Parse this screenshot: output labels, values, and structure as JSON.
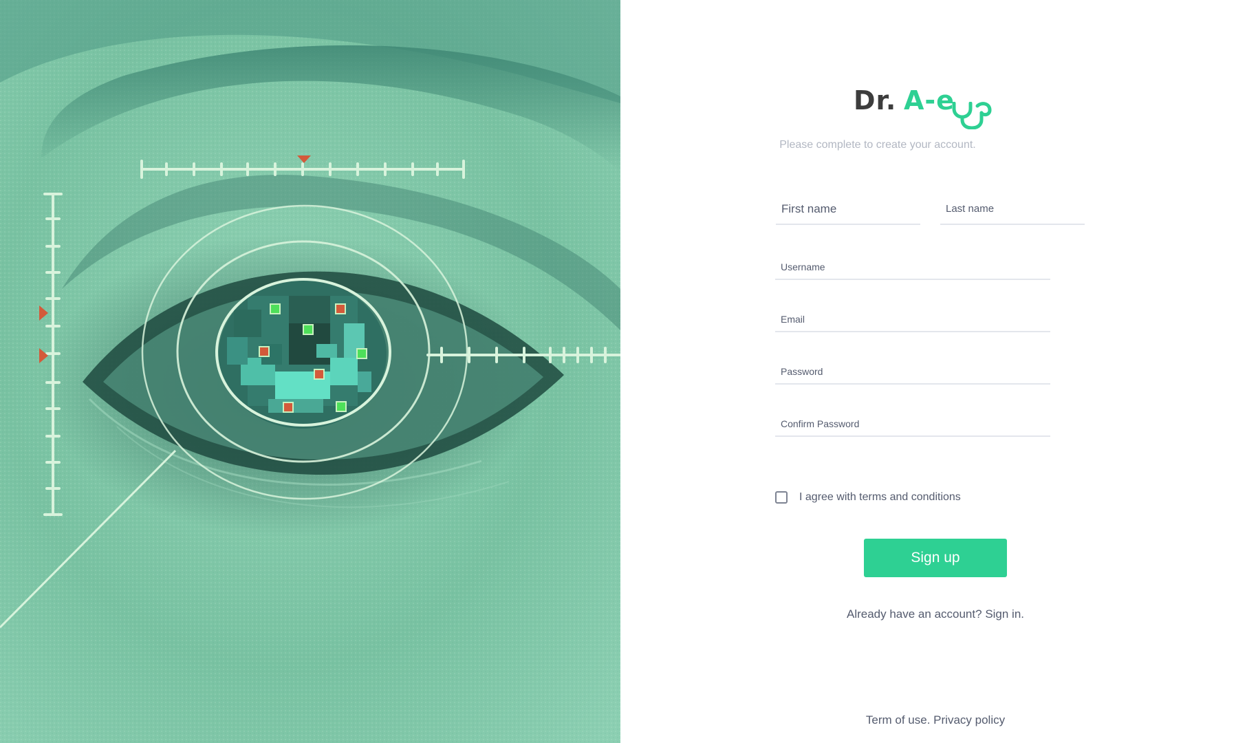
{
  "brand": {
    "prefix": "Dr.",
    "name": "A-eye",
    "name_visible": "A-e",
    "accent_color": "#2ed093",
    "dark_color": "#3d3d3d"
  },
  "form": {
    "subtitle": "Please complete to create your account.",
    "fields": {
      "first_name": {
        "placeholder": "First name",
        "value": ""
      },
      "last_name": {
        "placeholder": "Last name",
        "value": ""
      },
      "username": {
        "placeholder": "Username",
        "value": ""
      },
      "email": {
        "placeholder": "Email",
        "value": ""
      },
      "password": {
        "placeholder": "Password",
        "value": ""
      },
      "confirm_password": {
        "placeholder": "Confirm Password",
        "value": ""
      }
    },
    "terms_label": "I agree with terms and conditions",
    "terms_checked": false,
    "submit_label": "Sign up",
    "signin_prompt": "Already have an account?",
    "signin_link": "Sign in."
  },
  "footer": {
    "terms_link": "Term of use.",
    "privacy_link": "Privacy policy"
  },
  "hero": {
    "icon": "eye-scan-illustration",
    "tint_color": "#7fc4a8"
  }
}
